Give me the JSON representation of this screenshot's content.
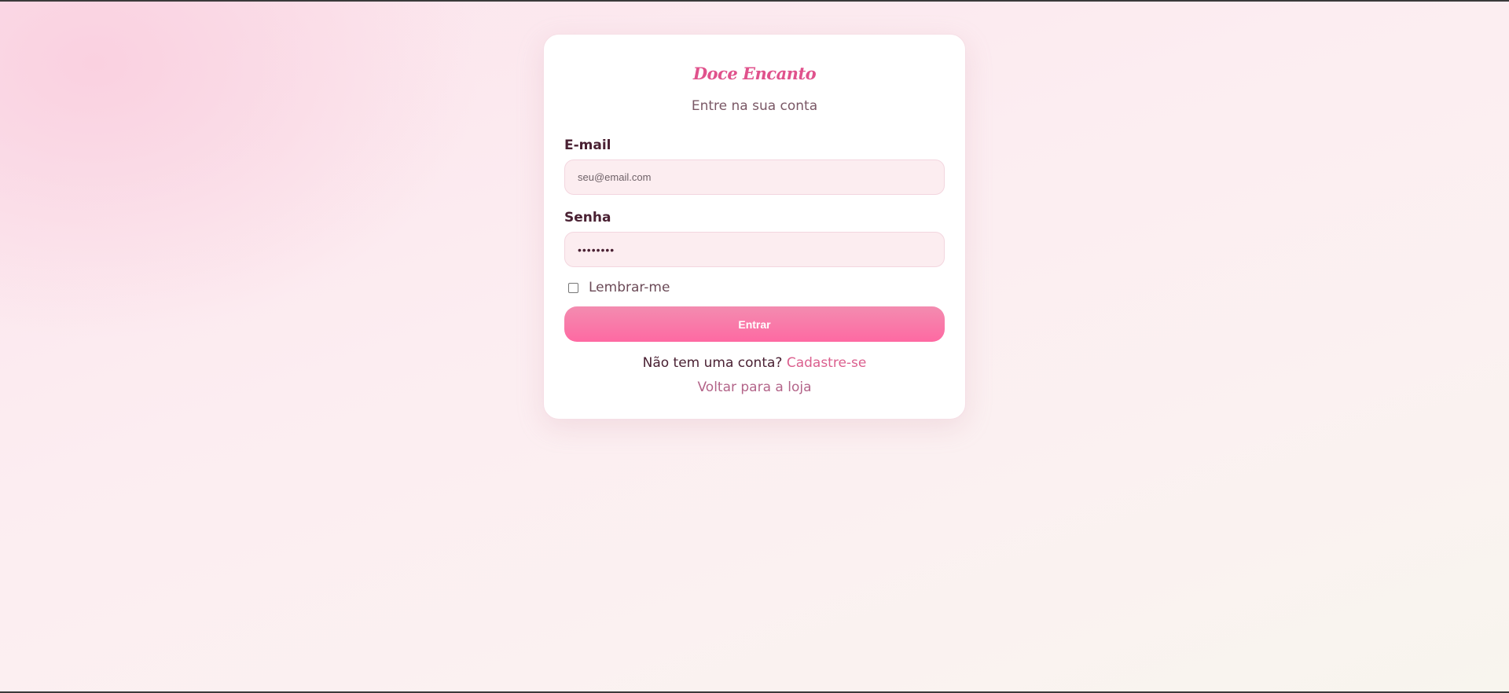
{
  "brand": {
    "name": "Doce Encanto"
  },
  "login": {
    "subtitle": "Entre na sua conta",
    "email_label": "E-mail",
    "email_placeholder": "seu@email.com",
    "email_value": "",
    "password_label": "Senha",
    "password_value": "••••••••",
    "remember_label": "Lembrar-me",
    "remember_checked": false,
    "submit_label": "Entrar",
    "signup_prompt": "Não tem uma conta?",
    "signup_link": "Cadastre-se",
    "back_link": "Voltar para a loja"
  },
  "colors": {
    "accent": "#e0528c",
    "button_gradient_top": "#f38cb0",
    "button_gradient_bottom": "#fe69a2",
    "input_background": "#fcedf0",
    "link": "#db5f8e",
    "heading_text": "#4a2133"
  }
}
